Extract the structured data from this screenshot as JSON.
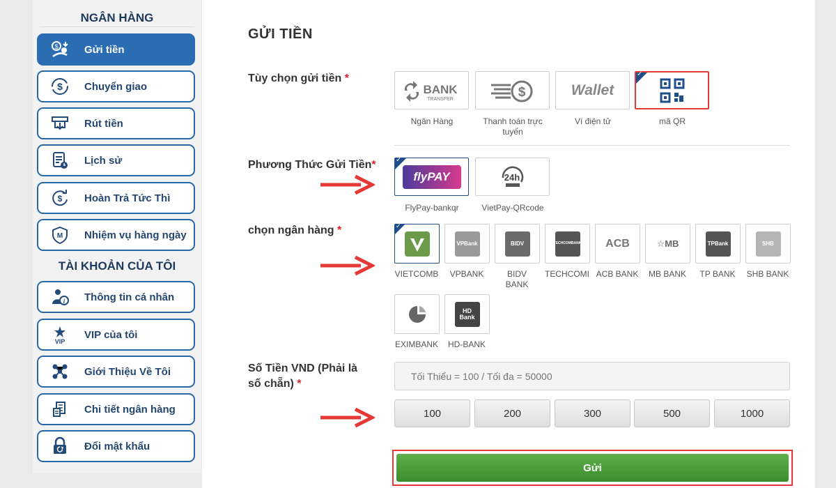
{
  "sidebar": {
    "bank_section_title": "NGÂN HÀNG",
    "account_section_title": "TÀI KHOẢN CỦA TÔI",
    "bank_items": [
      {
        "label": "Gửi tiền",
        "icon": "deposit-icon"
      },
      {
        "label": "Chuyển giao",
        "icon": "transfer-icon"
      },
      {
        "label": "Rút tiền",
        "icon": "withdraw-icon"
      },
      {
        "label": "Lịch sử",
        "icon": "history-icon"
      },
      {
        "label": "Hoàn Trả Tức Thì",
        "icon": "refund-icon"
      },
      {
        "label": "Nhiệm vụ hàng ngày",
        "icon": "mission-icon"
      }
    ],
    "account_items": [
      {
        "label": "Thông tin cá nhân",
        "icon": "user-info-icon"
      },
      {
        "label": "VIP của tôi",
        "icon": "vip-icon"
      },
      {
        "label": "Giới Thiệu Về Tôi",
        "icon": "referral-icon"
      },
      {
        "label": "Chi tiết ngân hàng",
        "icon": "bank-detail-icon"
      },
      {
        "label": "Đổi mật khẩu",
        "icon": "lock-icon"
      }
    ]
  },
  "main": {
    "title": "GỬI TIỀN",
    "deposit_option_label": "Tùy chọn gửi tiền",
    "method_label": "Phương Thức Gửi Tiền",
    "bank_label": "chọn ngân hàng",
    "amount_label_line1": "Số Tiền VND (Phải là",
    "amount_label_line2": "số chẵn)",
    "required_mark": "*",
    "deposit_options": [
      {
        "caption": "Ngân Hàng",
        "logo": "BANK",
        "logo_sub": "TRANSFER"
      },
      {
        "caption_line1": "Thanh toán trực",
        "caption_line2": "tuyến"
      },
      {
        "caption": "Ví điện tử",
        "logo": "Wallet"
      },
      {
        "caption": "mã QR",
        "selected": true
      }
    ],
    "methods": [
      {
        "caption": "FlyPay-bankqr",
        "logo": "flyPAY",
        "selected": true
      },
      {
        "caption": "VietPay-QRcode",
        "logo": "24h"
      }
    ],
    "banks": [
      {
        "caption": "VIETCOMB",
        "selected": true
      },
      {
        "caption": "VPBANK",
        "logo": "VPBank"
      },
      {
        "caption_line1": "BIDV",
        "caption_line2": "BANK",
        "logo": "BIDV"
      },
      {
        "caption": "TECHCOMI",
        "logo": "TECHCOMBANK"
      },
      {
        "caption": "ACB BANK",
        "logo": "ACB"
      },
      {
        "caption": "MB BANK",
        "logo": "MB"
      },
      {
        "caption": "TP BANK",
        "logo": "TPBank"
      },
      {
        "caption": "SHB BANK",
        "logo": "SHB"
      },
      {
        "caption": "EXIMBANK"
      },
      {
        "caption": "HD-BANK",
        "logo": "HD Bank"
      }
    ],
    "amount_placeholder": "Tối Thiểu = 100 / Tối đa = 50000",
    "amount_presets": [
      "100",
      "200",
      "300",
      "500",
      "1000"
    ],
    "submit_label": "Gửi"
  },
  "colors": {
    "sidebar_active": "#2a6db3",
    "accent_blue": "#1f4f8a",
    "required_red": "#e0202c",
    "highlight_red": "#e53935",
    "submit_green": "#4a9d3b"
  }
}
